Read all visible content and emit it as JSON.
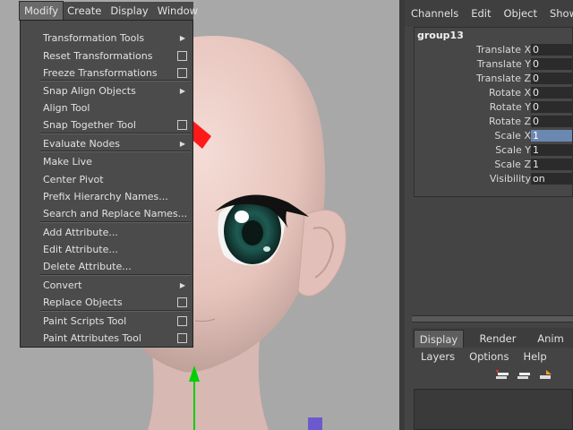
{
  "menubar": {
    "items": [
      "Modify",
      "Create",
      "Display",
      "Window"
    ],
    "active": "Modify"
  },
  "modify_menu": {
    "items": [
      {
        "label": "Transformation Tools",
        "submenu": true,
        "option_box": false
      },
      {
        "label": "Reset Transformations",
        "submenu": false,
        "option_box": true
      },
      {
        "label": "Freeze Transformations",
        "submenu": false,
        "option_box": true
      },
      {
        "label": "Snap Align Objects",
        "submenu": true,
        "option_box": false
      },
      {
        "label": "Align Tool",
        "submenu": false,
        "option_box": false
      },
      {
        "label": "Snap Together Tool",
        "submenu": false,
        "option_box": true
      },
      {
        "label": "Evaluate Nodes",
        "submenu": true,
        "option_box": false
      },
      {
        "label": "Make Live",
        "submenu": false,
        "option_box": false
      },
      {
        "label": "Center Pivot",
        "submenu": false,
        "option_box": false
      },
      {
        "label": "Prefix Hierarchy Names...",
        "submenu": false,
        "option_box": false
      },
      {
        "label": "Search and Replace Names...",
        "submenu": false,
        "option_box": false
      },
      {
        "label": "Add Attribute...",
        "submenu": false,
        "option_box": false
      },
      {
        "label": "Edit Attribute...",
        "submenu": false,
        "option_box": false
      },
      {
        "label": "Delete Attribute...",
        "submenu": false,
        "option_box": false
      },
      {
        "label": "Convert",
        "submenu": true,
        "option_box": false
      },
      {
        "label": "Replace Objects",
        "submenu": false,
        "option_box": true
      },
      {
        "label": "Paint Scripts Tool",
        "submenu": false,
        "option_box": true
      },
      {
        "label": "Paint Attributes Tool",
        "submenu": false,
        "option_box": true
      }
    ]
  },
  "channel_box": {
    "menu": [
      "Channels",
      "Edit",
      "Object",
      "Show"
    ],
    "object_name": "group13",
    "attributes": [
      {
        "label": "Translate X",
        "value": "0"
      },
      {
        "label": "Translate Y",
        "value": "0"
      },
      {
        "label": "Translate Z",
        "value": "0"
      },
      {
        "label": "Rotate X",
        "value": "0"
      },
      {
        "label": "Rotate Y",
        "value": "0"
      },
      {
        "label": "Rotate Z",
        "value": "0"
      },
      {
        "label": "Scale X",
        "value": "1",
        "selected": true
      },
      {
        "label": "Scale Y",
        "value": "1"
      },
      {
        "label": "Scale Z",
        "value": "1"
      },
      {
        "label": "Visibility",
        "value": "on"
      }
    ]
  },
  "layer_editor": {
    "tabs": [
      "Display",
      "Render",
      "Anim"
    ],
    "active_tab": "Display",
    "menu": [
      "Layers",
      "Options",
      "Help"
    ],
    "icons": [
      "new-layer-icon",
      "new-layer-selected-icon",
      "new-layer-options-icon"
    ]
  },
  "annotation": {
    "type": "red-arrow",
    "points_to": "Freeze Transformations",
    "color": "#ff1a1a"
  },
  "colors": {
    "selected_value": "#6a88b0",
    "menu_bg": "#4b4b4b",
    "viewport_bg": "#a8a8a8"
  }
}
